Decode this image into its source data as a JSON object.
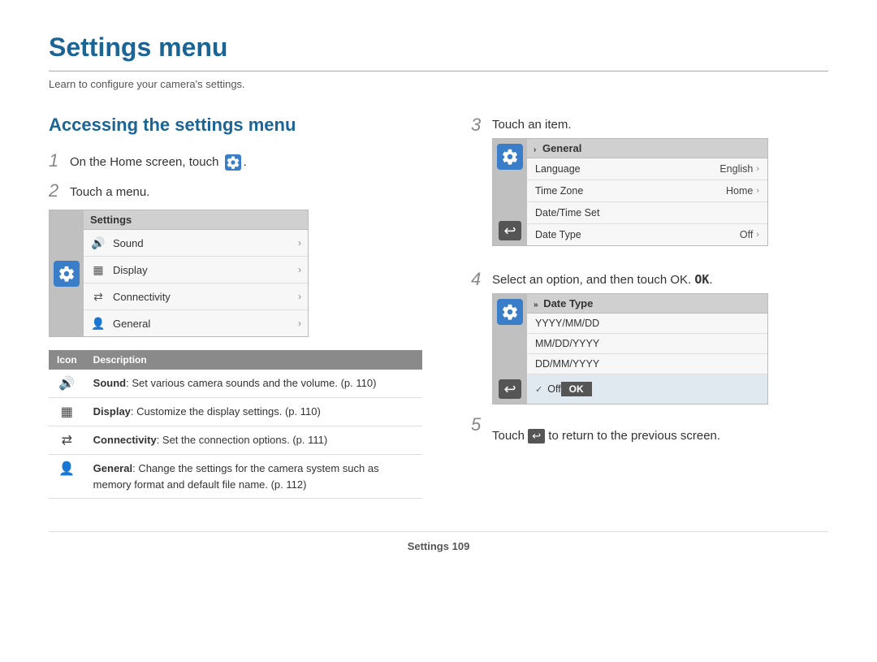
{
  "page": {
    "title": "Settings menu",
    "subtitle": "Learn to configure your camera's settings.",
    "footer_label": "Settings",
    "footer_page": "109"
  },
  "left_section": {
    "heading": "Accessing the settings menu",
    "step1": "On the Home screen, touch",
    "step2": "Touch a menu.",
    "mock_menu": {
      "header": "Settings",
      "items": [
        {
          "icon": "sound",
          "label": "Sound"
        },
        {
          "icon": "display",
          "label": "Display"
        },
        {
          "icon": "connectivity",
          "label": "Connectivity"
        },
        {
          "icon": "general",
          "label": "General"
        }
      ]
    },
    "icon_table": {
      "col_icon": "Icon",
      "col_desc": "Description",
      "rows": [
        {
          "icon": "sound",
          "desc_bold": "Sound",
          "desc_rest": ": Set various camera sounds and the volume. (p. 110)"
        },
        {
          "icon": "display",
          "desc_bold": "Display",
          "desc_rest": ": Customize the display settings. (p. 110)"
        },
        {
          "icon": "connectivity",
          "desc_bold": "Connectivity",
          "desc_rest": ": Set the connection options. (p. 111)"
        },
        {
          "icon": "general",
          "desc_bold": "General",
          "desc_rest": ": Change the settings for the camera system such as memory format and default file name. (p. 112)"
        }
      ]
    }
  },
  "right_section": {
    "step3_text": "Touch an item.",
    "step3_mock": {
      "header": "General",
      "rows": [
        {
          "label": "Language",
          "value": "English",
          "arrow": true
        },
        {
          "label": "Time Zone",
          "value": "Home",
          "arrow": true
        },
        {
          "label": "Date/Time Set",
          "value": "",
          "arrow": false
        },
        {
          "label": "Date Type",
          "value": "Off",
          "arrow": true
        }
      ]
    },
    "step4_text": "Select an option, and then touch OK.",
    "step4_mock": {
      "header": "Date Type",
      "rows": [
        {
          "label": "YYYY/MM/DD",
          "selected": false
        },
        {
          "label": "MM/DD/YYYY",
          "selected": false
        },
        {
          "label": "DD/MM/YYYY",
          "selected": false
        },
        {
          "label": "Off",
          "selected": true
        }
      ],
      "ok_label": "OK"
    },
    "step5_text": "Touch",
    "step5_text2": "to return to the previous screen."
  }
}
